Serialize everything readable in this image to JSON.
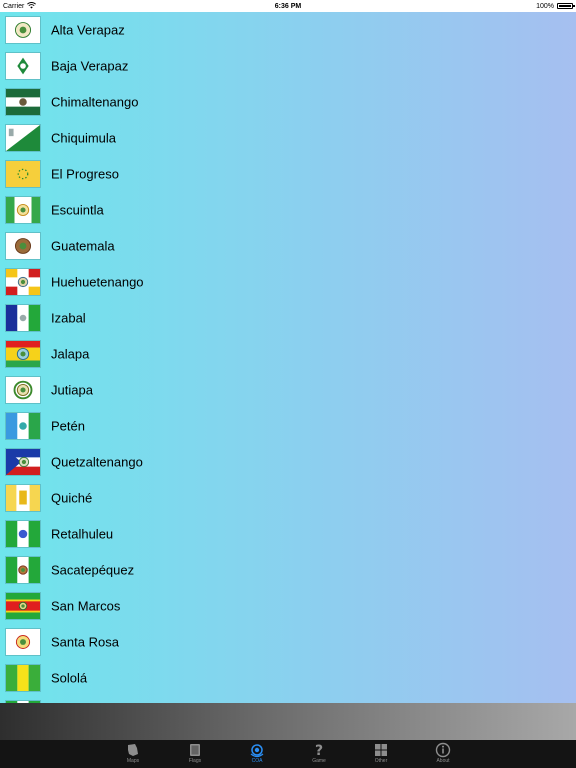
{
  "status": {
    "carrier": "Carrier",
    "time": "6:36 PM",
    "battery": "100%"
  },
  "departments": [
    {
      "name": "Alta Verapaz",
      "flag": "alta-verapaz-flag-icon"
    },
    {
      "name": "Baja Verapaz",
      "flag": "baja-verapaz-flag-icon"
    },
    {
      "name": "Chimaltenango",
      "flag": "chimaltenango-flag-icon"
    },
    {
      "name": "Chiquimula",
      "flag": "chiquimula-flag-icon"
    },
    {
      "name": "El Progreso",
      "flag": "el-progreso-flag-icon"
    },
    {
      "name": "Escuintla",
      "flag": "escuintla-flag-icon"
    },
    {
      "name": "Guatemala",
      "flag": "guatemala-flag-icon"
    },
    {
      "name": "Huehuetenango",
      "flag": "huehuetenango-flag-icon"
    },
    {
      "name": "Izabal",
      "flag": "izabal-flag-icon"
    },
    {
      "name": "Jalapa",
      "flag": "jalapa-flag-icon"
    },
    {
      "name": "Jutiapa",
      "flag": "jutiapa-flag-icon"
    },
    {
      "name": "Petén",
      "flag": "peten-flag-icon"
    },
    {
      "name": "Quetzaltenango",
      "flag": "quetzaltenango-flag-icon"
    },
    {
      "name": "Quiché",
      "flag": "quiche-flag-icon"
    },
    {
      "name": "Retalhuleu",
      "flag": "retalhuleu-flag-icon"
    },
    {
      "name": "Sacatepéquez",
      "flag": "sacatepequez-flag-icon"
    },
    {
      "name": "San Marcos",
      "flag": "san-marcos-flag-icon"
    },
    {
      "name": "Santa Rosa",
      "flag": "santa-rosa-flag-icon"
    },
    {
      "name": "Sololá",
      "flag": "solola-flag-icon"
    }
  ],
  "tabs": [
    {
      "label": "Maps",
      "icon": "map-icon"
    },
    {
      "label": "Flags",
      "icon": "flag-icon"
    },
    {
      "label": "COA",
      "icon": "coat-of-arms-icon",
      "active": true
    },
    {
      "label": "Game",
      "icon": "question-mark-icon"
    },
    {
      "label": "Other",
      "icon": "grid-icon"
    },
    {
      "label": "About",
      "icon": "info-icon"
    }
  ],
  "colors": {
    "active_tab": "#2a8ff5",
    "inactive_tab": "#8e8e8e",
    "tab_bar": "#141414"
  }
}
